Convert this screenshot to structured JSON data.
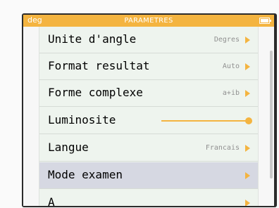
{
  "status_bar": {
    "angle_mode": "deg",
    "title": "PARAMETRES"
  },
  "menu": {
    "items": [
      {
        "label": "Unite d'angle",
        "value": "Degres"
      },
      {
        "label": "Format resultat",
        "value": "Auto"
      },
      {
        "label": "Forme complexe",
        "value": "a+ib"
      },
      {
        "label": "Luminosite",
        "value": ""
      },
      {
        "label": "Langue",
        "value": "Francais"
      },
      {
        "label": "Mode examen",
        "value": ""
      },
      {
        "label": "A",
        "value": ""
      }
    ],
    "selected_item": "Mode examen",
    "brightness_level": 1.0
  },
  "colors": {
    "accent": "#f4b440",
    "selected_row": "#d6d8e2",
    "menu_background": "#eef4ee"
  },
  "icons": [
    "battery-icon",
    "arrow-right-icon",
    "slider-knob"
  ]
}
